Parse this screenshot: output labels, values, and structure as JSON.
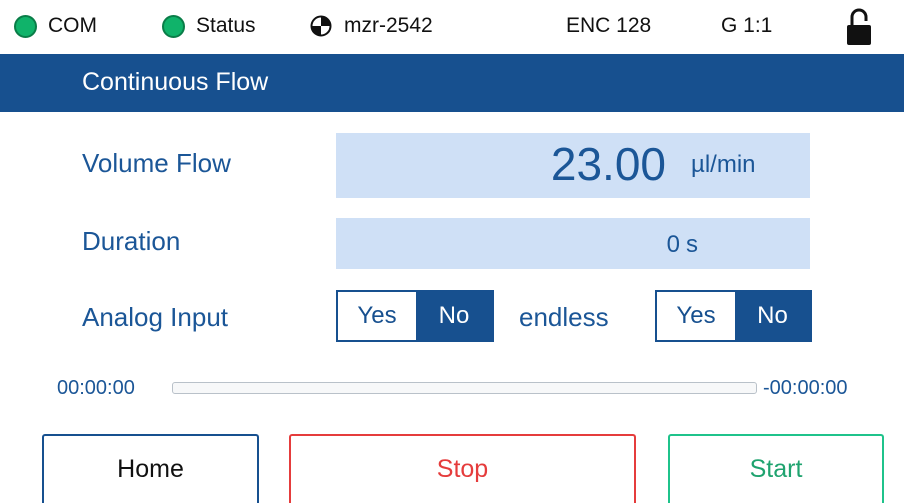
{
  "status_bar": {
    "com_label": "COM",
    "status_label": "Status",
    "device_name": "mzr-2542",
    "encoder": "ENC 128",
    "gear": "G 1:1",
    "indicator_color": "#10b36a",
    "lock_icon": "lock-unlocked-icon"
  },
  "header": {
    "title": "Continuous Flow"
  },
  "form": {
    "volume_flow": {
      "label": "Volume Flow",
      "value": "23.00",
      "unit": "µl/min"
    },
    "duration": {
      "label": "Duration",
      "value": "0",
      "unit": "s"
    },
    "analog_input": {
      "label": "Analog Input",
      "yes": "Yes",
      "no": "No",
      "selected": "No"
    },
    "endless": {
      "label": "endless",
      "yes": "Yes",
      "no": "No",
      "selected": "No"
    }
  },
  "progress": {
    "elapsed": "00:00:00",
    "remaining": "-00:00:00",
    "fraction": 0
  },
  "buttons": {
    "home": "Home",
    "stop": "Stop",
    "start": "Start"
  },
  "colors": {
    "primary": "#17508f",
    "field": "#cfe0f6",
    "stop": "#e53c3c",
    "start": "#1fc38b"
  }
}
